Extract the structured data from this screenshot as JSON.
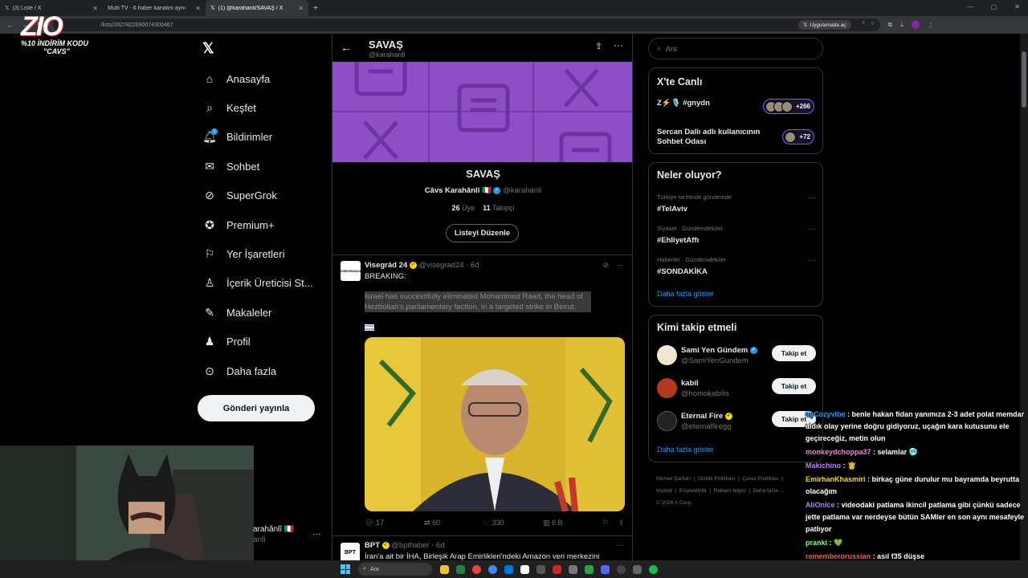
{
  "browser": {
    "tabs": [
      {
        "label": "(3) Liste / X"
      },
      {
        "label": "Multi TV - 6 haber kanalını aynı"
      },
      {
        "label": "(1) @karahanli/SAVAŞ / X"
      }
    ],
    "url": "/lists/2027822690074300467",
    "app_button": "Uygulamada aç"
  },
  "promo": {
    "brand": "ZIO",
    "line1": "%10 İNDİRİM KODU",
    "line2": "\"CAVS\""
  },
  "sidebar": {
    "items": [
      {
        "label": "Anasayfa",
        "icon": "home-icon"
      },
      {
        "label": "Keşfet",
        "icon": "search-icon"
      },
      {
        "label": "Bildirimler",
        "icon": "bell-icon",
        "badge": "1"
      },
      {
        "label": "Sohbet",
        "icon": "mail-icon"
      },
      {
        "label": "SuperGrok",
        "icon": "grok-icon"
      },
      {
        "label": "Premium+",
        "icon": "premium-icon"
      },
      {
        "label": "Yer İşaretleri",
        "icon": "bookmark-icon"
      },
      {
        "label": "İçerik Üreticisi St...",
        "icon": "studio-icon"
      },
      {
        "label": "Makaleler",
        "icon": "articles-icon"
      },
      {
        "label": "Profil",
        "icon": "profile-icon"
      },
      {
        "label": "Daha fazla",
        "icon": "more-icon"
      }
    ],
    "post_button": "Gönderi yayınla",
    "account_name": "arahânlî 🇮🇹",
    "account_handle": "anli"
  },
  "list": {
    "title": "SAVAŞ",
    "handle": "@karahanli",
    "name": "SAVAŞ",
    "owner_name": "Câvs Karahânlî 🇮🇹",
    "owner_handle": "@karahanli",
    "members": "26",
    "members_label": "Üye",
    "followers": "11",
    "followers_label": "Takipçi",
    "edit_button": "Listeyi Düzenle"
  },
  "tweet": {
    "name": "Visegrád 24",
    "handle": "@visegrad24",
    "time": "6d",
    "avatar_text": "VISEGRAD24",
    "line1": "BREAKING:",
    "body": "Israel has successfully eliminated Mohammed Raad, the head of Hezbollah's parliamentary faction, in a targeted strike in Beirut.",
    "replies": "17",
    "retweets": "60",
    "likes": "330",
    "views": "6 B"
  },
  "tweet2": {
    "name": "BPT",
    "handle": "@bpthaber",
    "time": "6d",
    "avatar_text": "BPT",
    "body": "İran'a ait bir İHA, Birleşik Arap Emirlikleri'ndeki Amazon veri merkezini"
  },
  "search": {
    "placeholder": "Ara"
  },
  "live": {
    "title": "X'te Canlı",
    "rows": [
      {
        "title": "Z⚡🎙️ #gnydn",
        "count": "+266"
      },
      {
        "title": "Sercan Dallı adlı kullanıcının Sohbet Odası",
        "count": "+72"
      }
    ]
  },
  "trends": {
    "title": "Neler oluyor?",
    "items": [
      {
        "context": "Türkiye tarihinde gündemde",
        "tag": "#TelAviv"
      },
      {
        "context": "Siyaset · Gündemdekiler",
        "tag": "#EhliyetAffı"
      },
      {
        "context": "Haberler · Gündemdekiler",
        "tag": "#SONDAKİKA"
      }
    ],
    "more": "Daha fazla göster"
  },
  "who": {
    "title": "Kimi takip etmeli",
    "items": [
      {
        "name": "Sami Yen Gündem",
        "handle": "@SamiYenGundem",
        "button": "Takip et"
      },
      {
        "name": "kabil",
        "handle": "@homokabilis",
        "button": "Takip et"
      },
      {
        "name": "Eternal Fire",
        "handle": "@eternalfiregg",
        "button": "Takip et"
      }
    ],
    "more": "Daha fazla göster"
  },
  "footer": {
    "links": [
      "Hizmet Şartları",
      "Gizlilik Politikası",
      "Çerez Politikası",
      "Imprint",
      "Erişilebilirlik",
      "Reklam bilgisi",
      "Daha fazla ...",
      "© 2026 X Corp."
    ]
  },
  "chat": {
    "messages": [
      {
        "user": "ayCozyvibe",
        "text": ": benle hakan fidan yanımıza 2-3 adet polat memdar aldık olay yerine doğru gidiyoruz, uçağın kara kutusunu ele geçireceğiz, metin olun",
        "color": "#1d9bf0"
      },
      {
        "user": "monkeydchoppa37",
        "text": ": selamlar 🥶",
        "color": "#ff7ad9"
      },
      {
        "user": "Makichino",
        "text": ": 👸",
        "color": "#b57bff"
      },
      {
        "user": "EmirhanKhasmiri",
        "text": ": birkaç güne durulur mu bayramda beyrutta olacağım",
        "color": "#ffd400"
      },
      {
        "user": "AliOnlce",
        "text": ": videodaki patlama ikincil patlama gibi çünkü sadece jette patlama var nerdeyse bütün SAMler en son aynı mesafeyle patlıyor",
        "color": "#b57bff"
      },
      {
        "user": "pranki",
        "text": ": 💚",
        "color": "#7bff7b"
      },
      {
        "user": "rememberorussian",
        "text": ": asıl f35 düşse",
        "color": "#ff4f4f"
      }
    ]
  },
  "taskbar": {
    "search_placeholder": "Ara"
  },
  "colors": {
    "accent": "#1d9bf0",
    "banner": "#8e4ec6",
    "live_pill": "#7856ff"
  }
}
